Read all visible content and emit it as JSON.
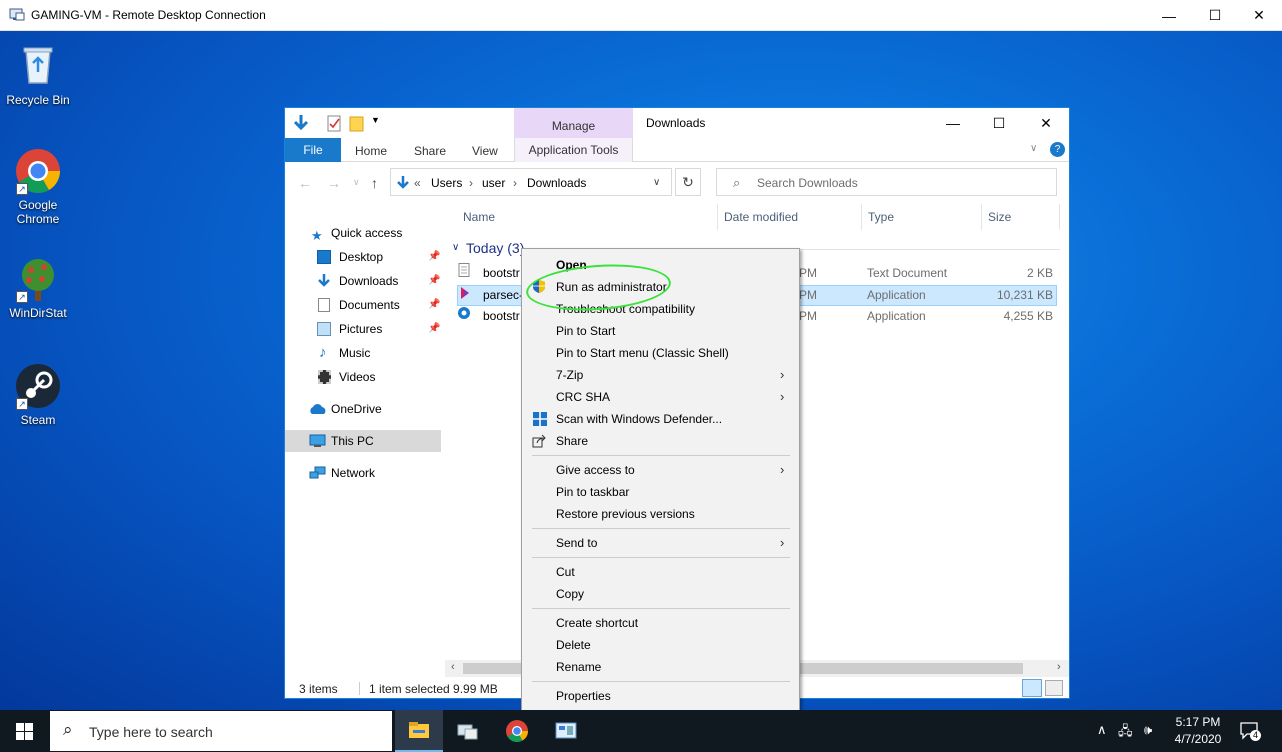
{
  "rdp_window": {
    "title": "GAMING-VM - Remote Desktop Connection",
    "minimize": "—",
    "maximize": "☐",
    "close": "✕"
  },
  "desktop_icons": [
    {
      "label": "Recycle Bin",
      "icon": "recycle-bin-icon"
    },
    {
      "label": "Google Chrome",
      "icon": "chrome-icon"
    },
    {
      "label": "WinDirStat",
      "icon": "windirstat-icon"
    },
    {
      "label": "Steam",
      "icon": "steam-icon"
    }
  ],
  "explorer": {
    "title": "Downloads",
    "manage_tab": "Manage",
    "ribbon_tabs": {
      "file": "File",
      "home": "Home",
      "share": "Share",
      "view": "View",
      "app_tools": "Application Tools"
    },
    "breadcrumb": {
      "prefix": "«",
      "items": [
        "Users",
        "user",
        "Downloads"
      ]
    },
    "search_placeholder": "Search Downloads",
    "nav_pane": [
      {
        "label": "Quick access",
        "icon": "star-icon"
      },
      {
        "label": "Desktop",
        "icon": "desktop-folder-icon",
        "pinned": true
      },
      {
        "label": "Downloads",
        "icon": "downloads-folder-icon",
        "pinned": true
      },
      {
        "label": "Documents",
        "icon": "documents-folder-icon",
        "pinned": true
      },
      {
        "label": "Pictures",
        "icon": "pictures-folder-icon",
        "pinned": true
      },
      {
        "label": "Music",
        "icon": "music-folder-icon"
      },
      {
        "label": "Videos",
        "icon": "videos-folder-icon"
      },
      {
        "label": "OneDrive",
        "icon": "onedrive-icon"
      },
      {
        "label": "This PC",
        "icon": "this-pc-icon",
        "selected": true
      },
      {
        "label": "Network",
        "icon": "network-icon"
      }
    ],
    "columns": {
      "name": "Name",
      "date": "Date modified",
      "type": "Type",
      "size": "Size"
    },
    "group": "Today (3)",
    "files": [
      {
        "name": "bootstr",
        "date": "PM",
        "type": "Text Document",
        "size": "2 KB",
        "icon": "text-file-icon"
      },
      {
        "name": "parsec-",
        "date": "PM",
        "type": "Application",
        "size": "10,231 KB",
        "icon": "parsec-app-icon",
        "selected": true
      },
      {
        "name": "bootstr",
        "date": "PM",
        "type": "Application",
        "size": "4,255 KB",
        "icon": "installer-app-icon"
      }
    ],
    "status": {
      "count": "3 items",
      "selection": "1 item selected  9.99 MB"
    }
  },
  "context_menu": {
    "items": [
      {
        "label": "Open",
        "bold": true
      },
      {
        "label": "Run as administrator",
        "icon": "uac-shield-icon"
      },
      {
        "label": "Troubleshoot compatibility"
      },
      {
        "label": "Pin to Start"
      },
      {
        "label": "Pin to Start menu (Classic Shell)"
      },
      {
        "label": "7-Zip",
        "submenu": true
      },
      {
        "label": "CRC SHA",
        "submenu": true
      },
      {
        "label": "Scan with Windows Defender...",
        "icon": "defender-icon"
      },
      {
        "label": "Share",
        "icon": "share-icon"
      },
      {
        "separator": true
      },
      {
        "label": "Give access to",
        "submenu": true
      },
      {
        "label": "Pin to taskbar"
      },
      {
        "label": "Restore previous versions"
      },
      {
        "separator": true
      },
      {
        "label": "Send to",
        "submenu": true
      },
      {
        "separator": true
      },
      {
        "label": "Cut"
      },
      {
        "label": "Copy"
      },
      {
        "separator": true
      },
      {
        "label": "Create shortcut"
      },
      {
        "label": "Delete"
      },
      {
        "label": "Rename"
      },
      {
        "separator": true
      },
      {
        "label": "Properties"
      }
    ]
  },
  "taskbar": {
    "search_placeholder": "Type here to search",
    "apps": [
      "file-explorer-icon",
      "rdp-icon",
      "chrome-icon",
      "control-panel-icon"
    ],
    "clock_time": "5:17 PM",
    "clock_date": "4/7/2020",
    "notification_count": "4"
  },
  "colors": {
    "desktop": "#0a6fd8",
    "file_tab": "#1979ca",
    "manage_tab": "#e9d7f7",
    "selection": "#cce8ff",
    "highlight_ring": "#3be23b",
    "taskbar": "#101820"
  }
}
